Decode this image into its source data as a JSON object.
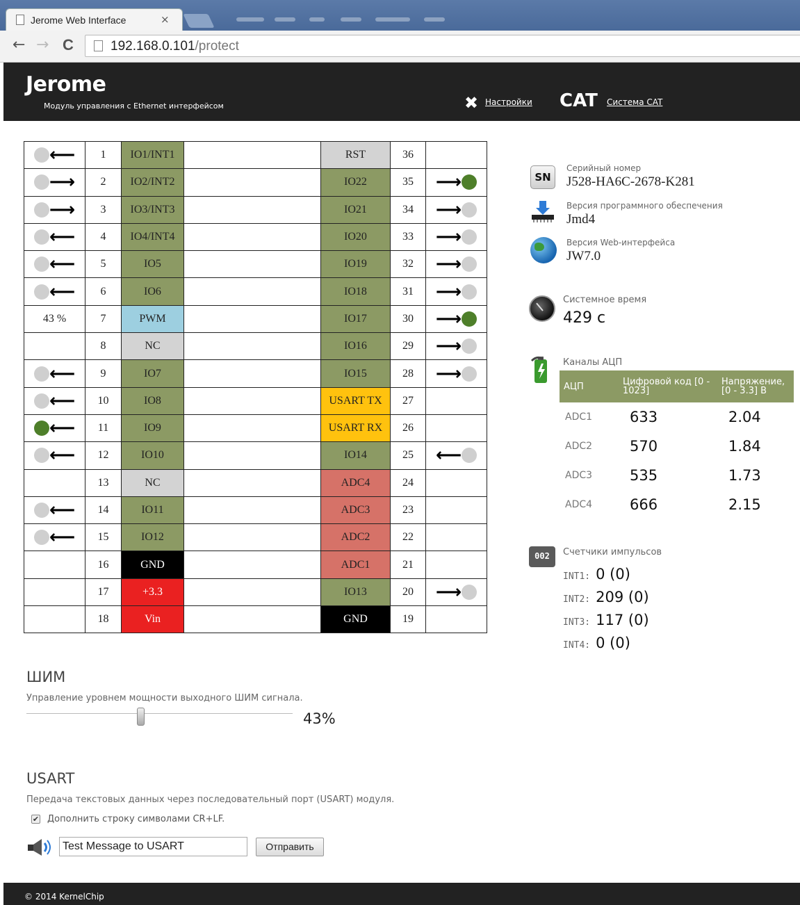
{
  "browser": {
    "tab_title": "Jerome Web Interface",
    "tab_close": "×",
    "url_host": "192.168.0.101",
    "url_path": "/protect",
    "back": "←",
    "forward": "→",
    "reload": "C"
  },
  "header": {
    "brand": "Jerome",
    "subtitle": "Модуль управления с Ethernet интерфейсом",
    "settings_icon": "✖",
    "settings_label": "Настройки",
    "cat_logo": "CAT",
    "cat_label": "Система CAT"
  },
  "pins_left": [
    {
      "num": "1",
      "name": "IO1/INT1",
      "color": "g",
      "state": "in",
      "on": false
    },
    {
      "num": "2",
      "name": "IO2/INT2",
      "color": "g",
      "state": "out",
      "on": false
    },
    {
      "num": "3",
      "name": "IO3/INT3",
      "color": "g",
      "state": "out",
      "on": false
    },
    {
      "num": "4",
      "name": "IO4/INT4",
      "color": "g",
      "state": "in",
      "on": false
    },
    {
      "num": "5",
      "name": "IO5",
      "color": "g",
      "state": "in",
      "on": false
    },
    {
      "num": "6",
      "name": "IO6",
      "color": "g",
      "state": "in",
      "on": false
    },
    {
      "num": "7",
      "name": "PWM",
      "color": "blue",
      "state": "pct",
      "text": "43 %"
    },
    {
      "num": "8",
      "name": "NC",
      "color": "grey",
      "state": "none"
    },
    {
      "num": "9",
      "name": "IO7",
      "color": "g",
      "state": "in",
      "on": false
    },
    {
      "num": "10",
      "name": "IO8",
      "color": "g",
      "state": "in",
      "on": false
    },
    {
      "num": "11",
      "name": "IO9",
      "color": "g",
      "state": "in",
      "on": true
    },
    {
      "num": "12",
      "name": "IO10",
      "color": "g",
      "state": "in",
      "on": false
    },
    {
      "num": "13",
      "name": "NC",
      "color": "grey",
      "state": "none"
    },
    {
      "num": "14",
      "name": "IO11",
      "color": "g",
      "state": "in",
      "on": false
    },
    {
      "num": "15",
      "name": "IO12",
      "color": "g",
      "state": "in",
      "on": false
    },
    {
      "num": "16",
      "name": "GND",
      "color": "black",
      "state": "none"
    },
    {
      "num": "17",
      "name": "+3.3",
      "color": "red",
      "state": "none"
    },
    {
      "num": "18",
      "name": "Vin",
      "color": "red",
      "state": "none"
    }
  ],
  "pins_right": [
    {
      "num": "36",
      "name": "RST",
      "color": "grey",
      "state": "none"
    },
    {
      "num": "35",
      "name": "IO22",
      "color": "g",
      "state": "out",
      "on": true
    },
    {
      "num": "34",
      "name": "IO21",
      "color": "g",
      "state": "out",
      "on": false
    },
    {
      "num": "33",
      "name": "IO20",
      "color": "g",
      "state": "out",
      "on": false
    },
    {
      "num": "32",
      "name": "IO19",
      "color": "g",
      "state": "out",
      "on": false
    },
    {
      "num": "31",
      "name": "IO18",
      "color": "g",
      "state": "out",
      "on": false
    },
    {
      "num": "30",
      "name": "IO17",
      "color": "g",
      "state": "out",
      "on": true
    },
    {
      "num": "29",
      "name": "IO16",
      "color": "g",
      "state": "out",
      "on": false
    },
    {
      "num": "28",
      "name": "IO15",
      "color": "g",
      "state": "out",
      "on": false
    },
    {
      "num": "27",
      "name": "USART TX",
      "color": "orange",
      "state": "none"
    },
    {
      "num": "26",
      "name": "USART RX",
      "color": "orange",
      "state": "none"
    },
    {
      "num": "25",
      "name": "IO14",
      "color": "g",
      "state": "in",
      "on": false
    },
    {
      "num": "24",
      "name": "ADC4",
      "color": "rose",
      "state": "none"
    },
    {
      "num": "23",
      "name": "ADC3",
      "color": "rose",
      "state": "none"
    },
    {
      "num": "22",
      "name": "ADC2",
      "color": "rose",
      "state": "none"
    },
    {
      "num": "21",
      "name": "ADC1",
      "color": "rose",
      "state": "none"
    },
    {
      "num": "20",
      "name": "IO13",
      "color": "g",
      "state": "out",
      "on": false
    },
    {
      "num": "19",
      "name": "GND",
      "color": "black",
      "state": "none"
    }
  ],
  "info": {
    "sn_icon": "SN",
    "serial_label": "Серийный номер",
    "serial_value": "J528-HA6C-2678-K281",
    "fw_label": "Версия программного обеспечения",
    "fw_value": "Jmd4",
    "web_label": "Версия Web-интерфейса",
    "web_value": "JW7.0",
    "time_label": "Системное время",
    "time_value": "429 с",
    "adc_label": "Каналы АЦП",
    "adc_headers": [
      "АЦП",
      "Цифровой код [0 - 1023]",
      "Напряжение, [0 - 3.3] В"
    ],
    "adc_rows": [
      {
        "name": "ADC1",
        "code": "633",
        "volt": "2.04"
      },
      {
        "name": "ADC2",
        "code": "570",
        "volt": "1.84"
      },
      {
        "name": "ADC3",
        "code": "535",
        "volt": "1.73"
      },
      {
        "name": "ADC4",
        "code": "666",
        "volt": "2.15"
      }
    ],
    "counters_icon": "002",
    "counters_label": "Счетчики импульсов",
    "counters": [
      {
        "label": "INT1:",
        "value": "0 (0)"
      },
      {
        "label": "INT2:",
        "value": "209 (0)"
      },
      {
        "label": "INT3:",
        "value": "117 (0)"
      },
      {
        "label": "INT4:",
        "value": "0 (0)"
      }
    ]
  },
  "pwm": {
    "title": "ШИМ",
    "desc": "Управление уровнем мощности выходного ШИМ сигнала.",
    "value_text": "43%",
    "level": 0.43
  },
  "usart": {
    "title": "USART",
    "desc": "Передача текстовых данных через последовательный порт (USART) модуля.",
    "checkbox_mark": "✔",
    "checkbox_label": "Дополнить строку символами CR+LF.",
    "input_value": "Test Message to USART",
    "send_label": "Отправить"
  },
  "footer": {
    "text": "© 2014 KernelChip"
  }
}
